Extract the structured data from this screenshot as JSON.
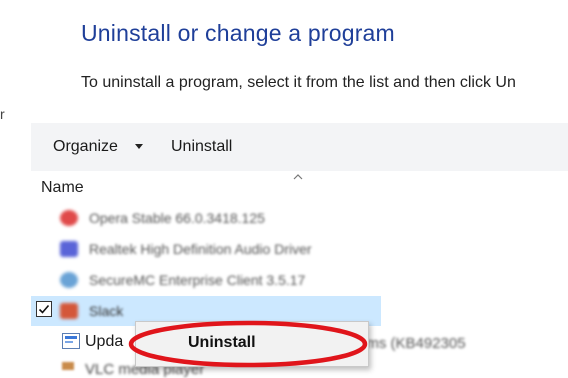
{
  "header": {
    "title": "Uninstall or change a program",
    "description": "To uninstall a program, select it from the list and then click Un",
    "left_edge_letter": "r"
  },
  "toolbar": {
    "organize_label": "Organize",
    "uninstall_label": "Uninstall"
  },
  "list": {
    "column_header": "Name",
    "rows": [
      {
        "label": "Opera Stable 66.0.3418.125",
        "icon": "opera-icon",
        "color": "#e04a4a"
      },
      {
        "label": "Realtek High Definition Audio Driver",
        "icon": "realtek-icon",
        "color": "#5a64d8"
      },
      {
        "label": "SecureMC Enterprise Client 3.5.17",
        "icon": "secure-client-icon",
        "color": "#6aa3d6"
      },
      {
        "label": "Slack",
        "icon": "slack-icon",
        "color": "#d4573a",
        "selected": true
      }
    ],
    "update_row": {
      "label": "Upda",
      "tail": "ed Systems (KB492305",
      "icon": "update-icon"
    },
    "bottom_row": {
      "label": "VLC media player",
      "icon": "vlc-icon"
    }
  },
  "context_menu": {
    "uninstall_label": "Uninstall"
  },
  "colors": {
    "title": "#1f3f99",
    "selection": "#cce8ff",
    "highlight_ellipse": "#e0151b"
  }
}
